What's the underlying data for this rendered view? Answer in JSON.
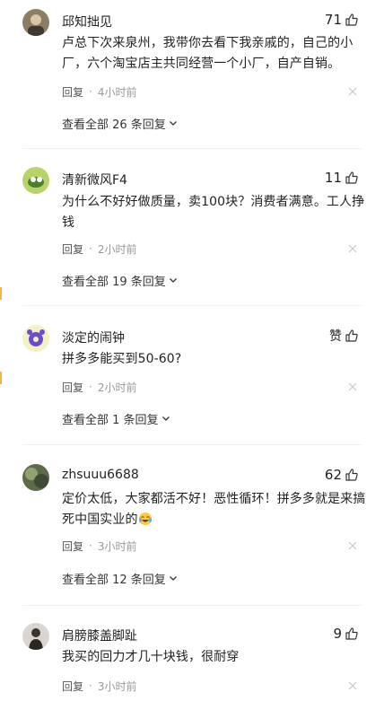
{
  "comments": [
    {
      "author": "邱知拙见",
      "likes": "71",
      "text": "卢总下次来泉州，我带你去看下我亲戚的，自己的小厂，六个淘宝店主共同经营一个小厂，自产自销。",
      "reply_label": "回复",
      "time": "4小时前",
      "view_replies": "查看全部 26 条回复"
    },
    {
      "author": "清新微风F4",
      "likes": "11",
      "text": "为什么不好好做质量，卖100块？消费者满意。工人挣钱",
      "reply_label": "回复",
      "time": "2小时前",
      "view_replies": "查看全部 19 条回复"
    },
    {
      "author": "淡定的闹钟",
      "likes": "赞",
      "text": "拼多多能买到50-60?",
      "reply_label": "回复",
      "time": "2小时前",
      "view_replies": "查看全部 1 条回复"
    },
    {
      "author": "zhsuuu6688",
      "likes": "62",
      "text": "定价太低，大家都活不好！恶性循环！拼多多就是来搞死中国实业的",
      "reply_label": "回复",
      "time": "3小时前",
      "view_replies": "查看全部 12 条回复"
    },
    {
      "author": "肩膀膝盖脚趾",
      "likes": "9",
      "text": "我买的回力才几十块钱，很耐穿",
      "reply_label": "回复",
      "time": "3小时前"
    }
  ],
  "icons": {
    "like": "thumbs-up-icon",
    "close": "close-icon",
    "expand": "chevron-down-icon",
    "emoji": "crying-laughing-emoji"
  },
  "colors": {
    "accent_edge": "#f2b544",
    "meta_text": "#999999",
    "body_text": "#222222"
  }
}
